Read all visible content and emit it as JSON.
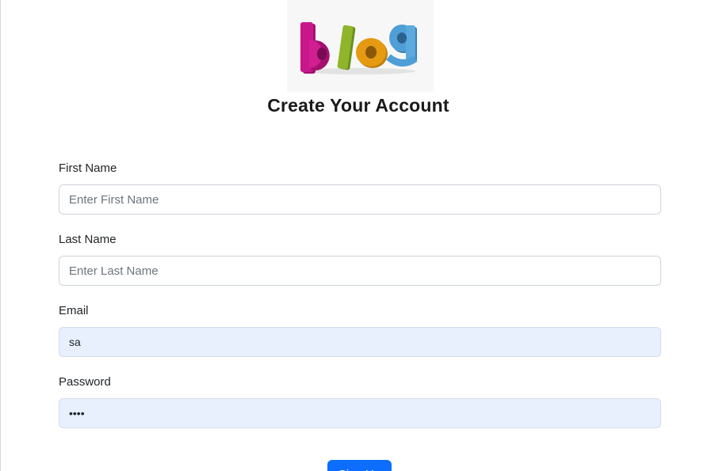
{
  "logo": {
    "alt": "blog",
    "letters": [
      "b",
      "l",
      "o",
      "g"
    ],
    "colors": [
      "#c9178b",
      "#8fb52b",
      "#e59a12",
      "#4f9fd6"
    ]
  },
  "page_title": "Create Your Account",
  "form": {
    "first_name": {
      "label": "First Name",
      "placeholder": "Enter First Name",
      "value": ""
    },
    "last_name": {
      "label": "Last Name",
      "placeholder": "Enter Last Name",
      "value": ""
    },
    "email": {
      "label": "Email",
      "placeholder": "",
      "value": "sa"
    },
    "password": {
      "label": "Password",
      "placeholder": "",
      "value": "1234"
    },
    "submit_label": "Sign Up"
  },
  "colors": {
    "accent": "#0d6efd",
    "autofill_bg": "#e8f0fe",
    "border": "#ced4da"
  }
}
